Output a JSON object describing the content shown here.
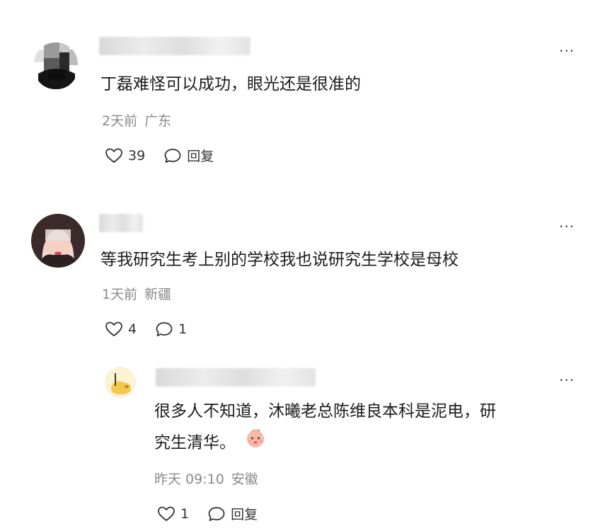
{
  "comments": [
    {
      "text": "丁磊难怪可以成功，眼光还是很准的",
      "time": "2天前",
      "location": "广东",
      "likes": "39",
      "reply_label": "回复"
    },
    {
      "text": "等我研究生考上别的学校我也说研究生学校是母校",
      "time": "1天前",
      "location": "新疆",
      "likes": "4",
      "replies": "1"
    }
  ],
  "reply": {
    "text_line1": "很多人不知道，沐曦老总陈维良本科是泥电，研",
    "text_line2": "究生清华。",
    "time": "昨天 09:10",
    "location": "安徽",
    "likes": "1",
    "reply_label": "回复"
  },
  "more_label": "···"
}
